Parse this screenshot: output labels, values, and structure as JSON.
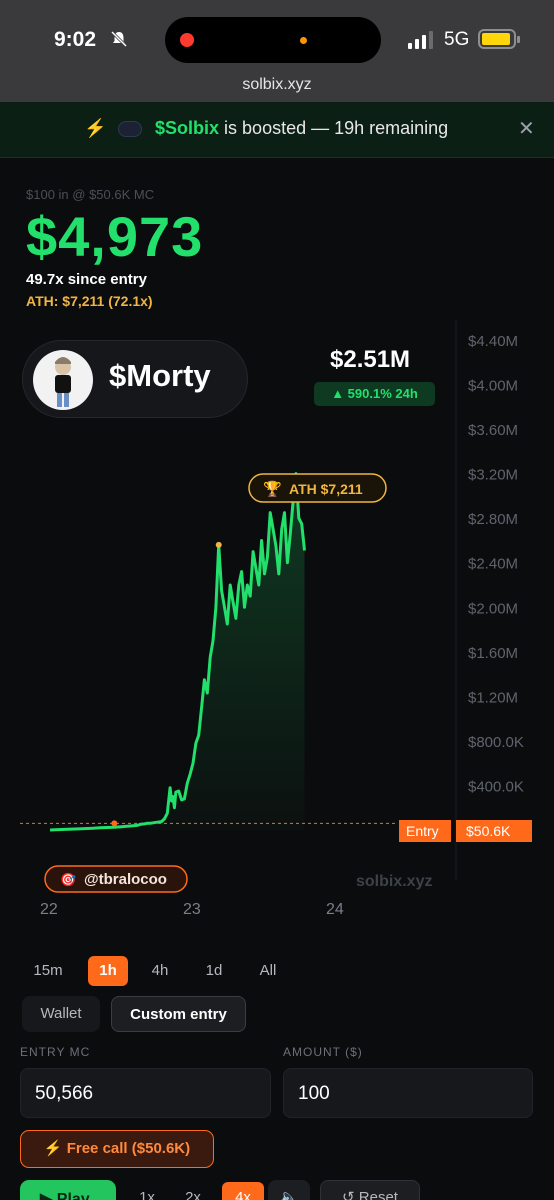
{
  "status_bar": {
    "time": "9:02",
    "network": "5G",
    "url": "solbix.xyz"
  },
  "banner": {
    "token": "$Solbix",
    "message": "is boosted — 19h remaining"
  },
  "pnl": {
    "subtitle": "$100 in @ $50.6K MC",
    "value": "$4,973",
    "since_entry": "49.7x since entry",
    "ath": "ATH: $7,211 (72.1x)"
  },
  "token": {
    "name": "$Morty",
    "market_cap": "$2.51M",
    "change": "▲ 590.1% 24h"
  },
  "chart_data": {
    "type": "line",
    "y_ticks": [
      "$4.40M",
      "$4.00M",
      "$3.60M",
      "$3.20M",
      "$2.80M",
      "$2.40M",
      "$2.00M",
      "$1.60M",
      "$1.20M",
      "$800.0K",
      "$400.0K"
    ],
    "x_ticks": [
      "22",
      "23",
      "24"
    ],
    "ylim": [
      0,
      4400000
    ],
    "x": [
      0,
      0.1,
      0.2,
      0.3,
      0.35,
      0.45,
      0.5,
      0.55,
      0.6,
      0.62,
      0.63,
      0.66,
      0.68,
      0.7,
      0.72,
      0.75,
      0.78,
      0.8,
      0.82,
      0.84,
      0.85,
      0.86,
      0.87,
      0.88,
      0.9,
      0.92,
      0.94,
      0.96,
      0.98,
      1.0,
      1.02,
      1.04,
      1.06,
      1.08,
      1.1,
      1.12,
      1.14,
      1.16,
      1.18,
      1.2,
      1.22,
      1.24,
      1.26,
      1.28,
      1.3,
      1.32,
      1.34,
      1.36,
      1.38,
      1.4,
      1.42,
      1.44,
      1.46,
      1.48,
      1.5,
      1.52,
      1.54,
      1.56,
      1.58,
      1.6,
      1.62,
      1.64,
      1.66,
      1.68,
      1.7,
      1.72,
      1.74,
      1.76,
      1.78
    ],
    "y": [
      0,
      5000,
      10000,
      15000,
      20000,
      25000,
      30000,
      35000,
      40000,
      45000,
      50000,
      55000,
      60000,
      60000,
      65000,
      70000,
      75000,
      100000,
      150000,
      380000,
      260000,
      300000,
      200000,
      340000,
      350000,
      270000,
      280000,
      420000,
      500000,
      600000,
      780000,
      850000,
      1100000,
      1350000,
      1230000,
      1550000,
      1700000,
      2000000,
      2560000,
      2150000,
      2000000,
      1850000,
      2200000,
      2050000,
      1900000,
      2200000,
      2320000,
      2000000,
      2200000,
      2100000,
      2500000,
      2350000,
      2200000,
      2600000,
      2300000,
      2450000,
      2850000,
      2700000,
      2550000,
      2300000,
      2700000,
      2850000,
      2400000,
      2650000,
      2950000,
      3200000,
      2800000,
      2750000,
      2510000
    ],
    "entry_label": "Entry",
    "entry_value": "$50.6K",
    "entry_mc": 50566,
    "ath_label": "ATH $7,211",
    "caller": "@tbralocoo",
    "watermark": "solbix.xyz",
    "line_color": "#22e06b"
  },
  "timeframes": [
    "15m",
    "1h",
    "4h",
    "1d",
    "All"
  ],
  "active_timeframe": "1h",
  "modes": {
    "wallet": "Wallet",
    "custom": "Custom entry"
  },
  "form": {
    "entry_label": "ENTRY MC",
    "entry_value": "50,566",
    "amount_label": "AMOUNT ($)",
    "amount_value": "100"
  },
  "free_call": "Free call ($50.6K)",
  "playback": {
    "play": "Play",
    "speeds": [
      "1x",
      "2x",
      "4x"
    ],
    "active_speed": "4x",
    "reset": "Reset"
  }
}
